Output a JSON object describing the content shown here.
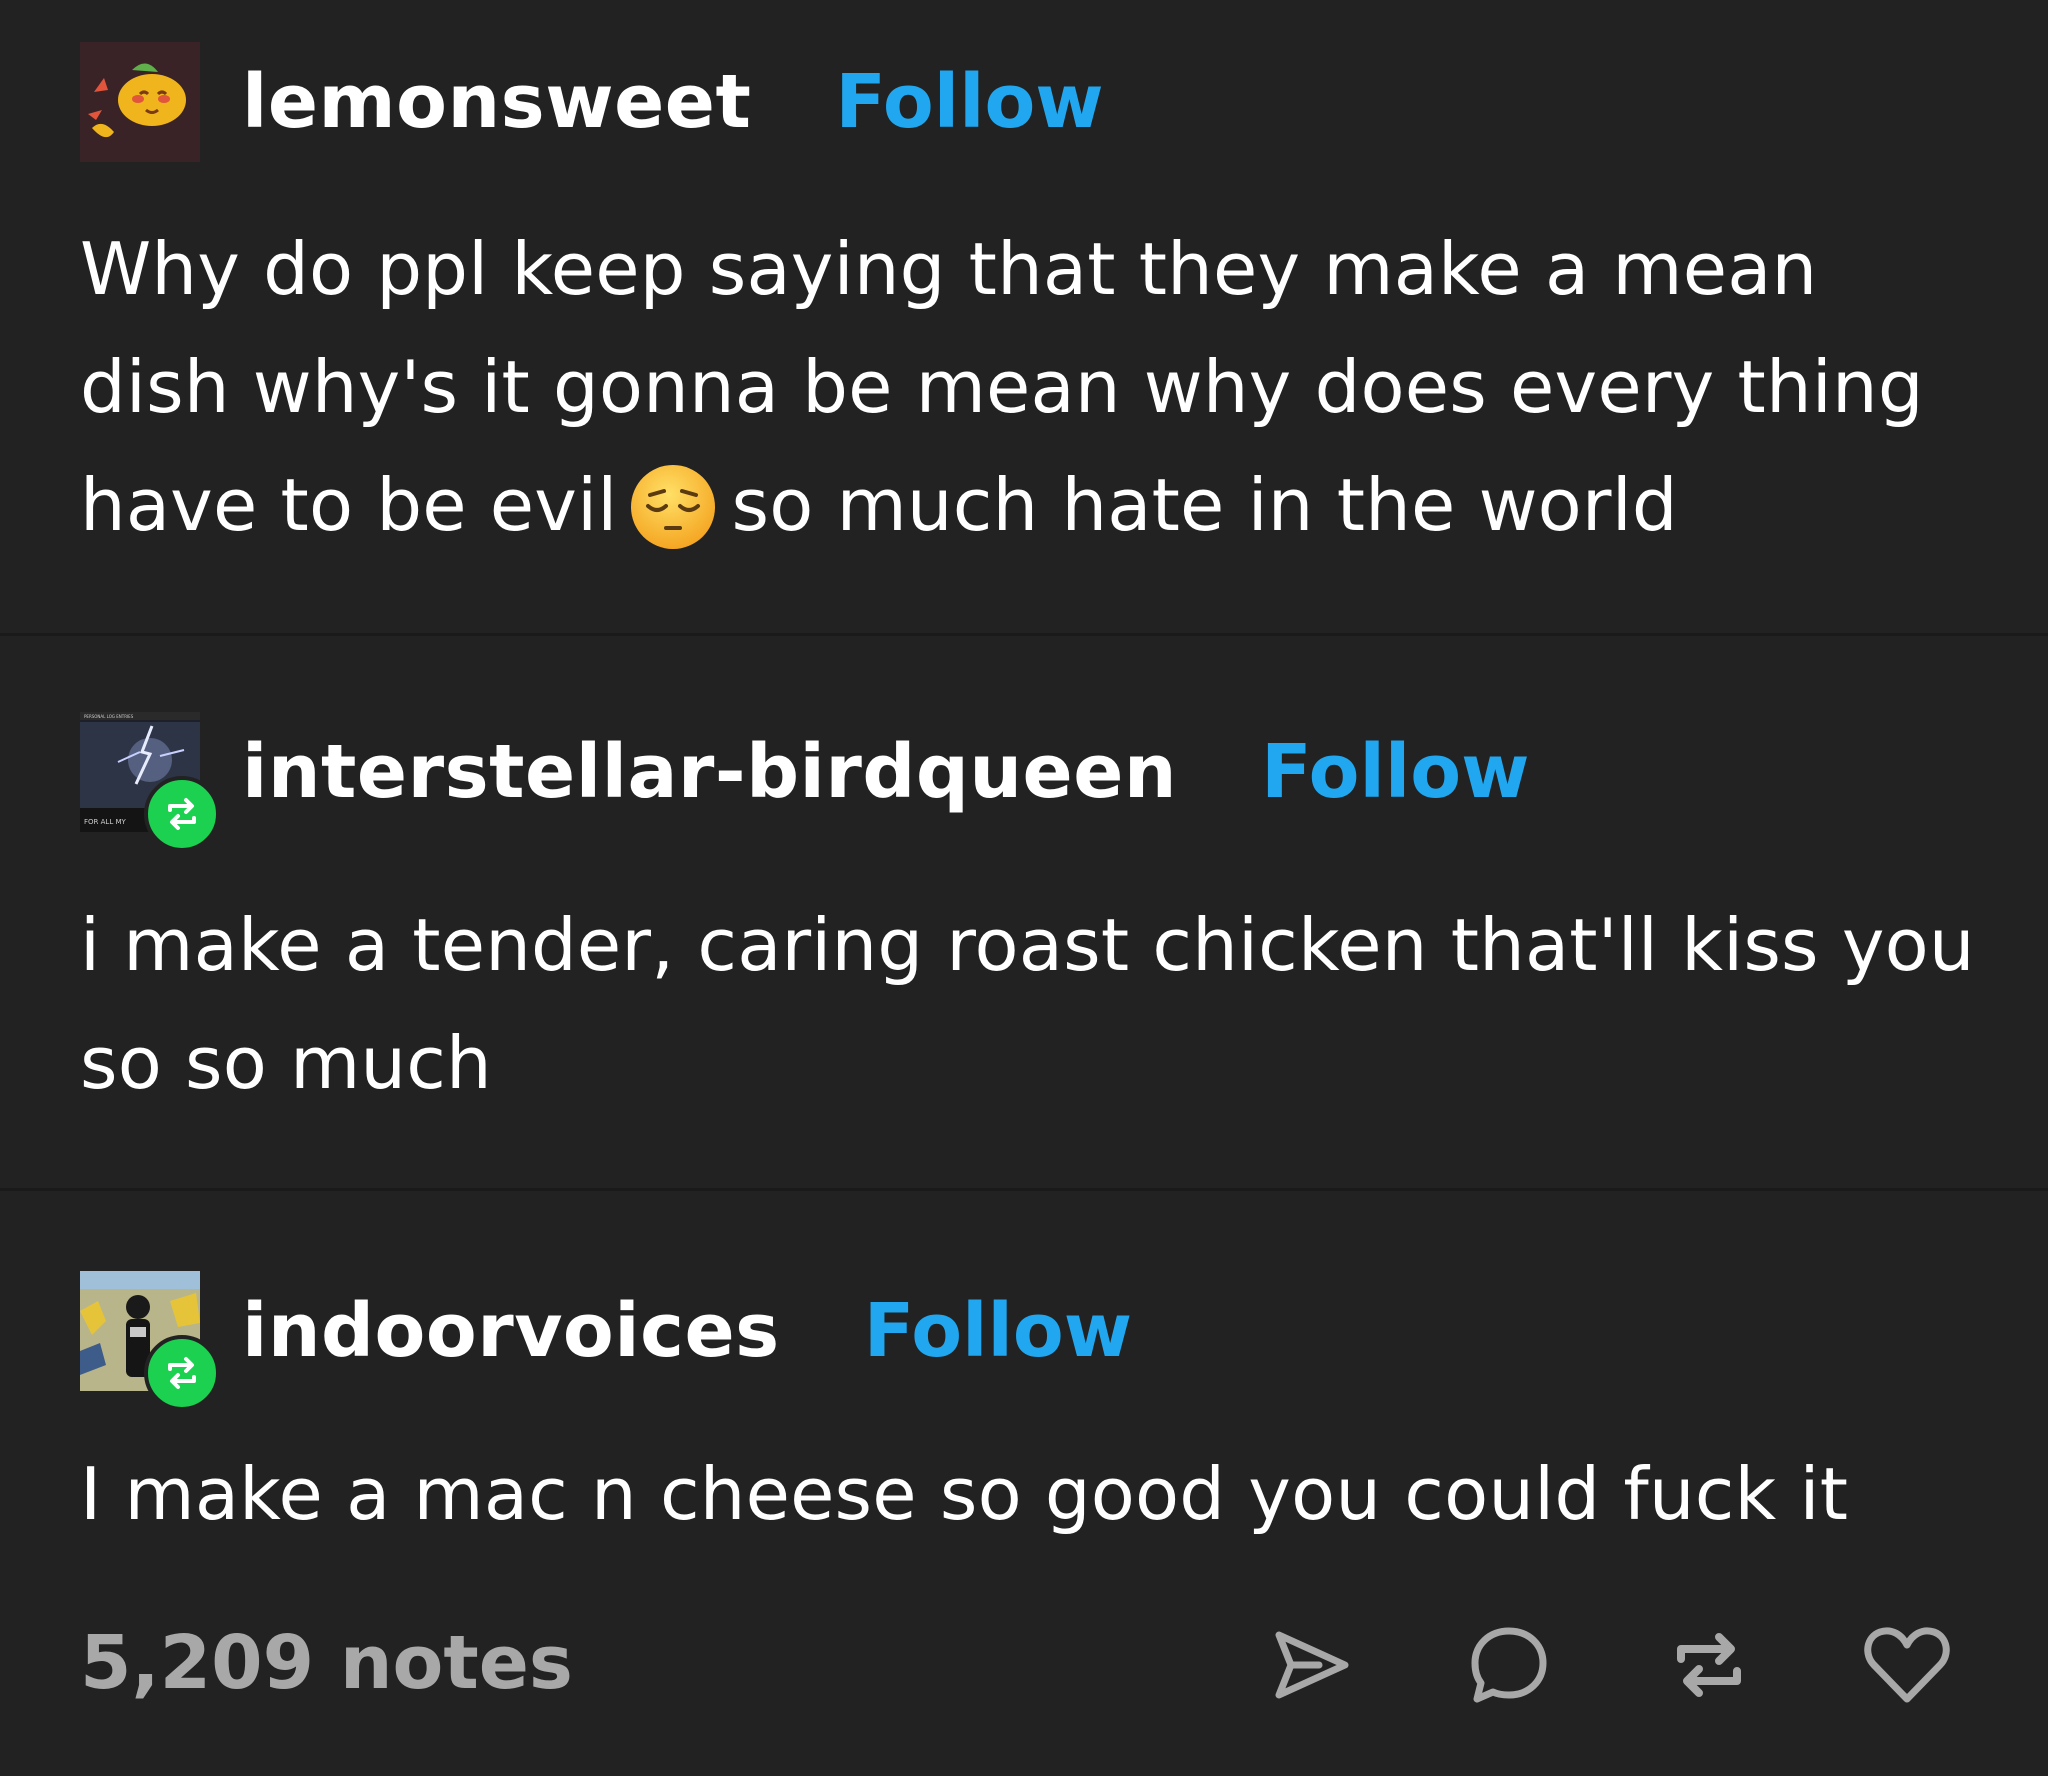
{
  "reblogs": [
    {
      "username": "lemonsweet",
      "follow_label": "Follow",
      "avatar_icon": "lemon-avatar",
      "is_reblog": false,
      "text_before_emoji": "Why do ppl keep saying that they make a mean dish why's it gonna be mean why does every thing have to be evil",
      "emoji": "pensive-face-emoji",
      "text_after_emoji": "so much hate in the world"
    },
    {
      "username": "interstellar-birdqueen",
      "follow_label": "Follow",
      "avatar_icon": "lightning-avatar",
      "avatar_caption_top": "PERSONAL LOG ENTRIES",
      "avatar_caption_bottom": "FOR ALL MY",
      "is_reblog": true,
      "text": "i make a tender, caring roast chicken that'll kiss you so so much"
    },
    {
      "username": "indoorvoices",
      "follow_label": "Follow",
      "avatar_icon": "person-avatar",
      "is_reblog": true,
      "text": "I make a mac n cheese so good you could fuck it"
    }
  ],
  "footer": {
    "notes": "5,209 notes",
    "actions": [
      "share-icon",
      "reply-icon",
      "reblog-icon",
      "like-icon"
    ]
  },
  "colors": {
    "background": "#222222",
    "follow_link": "#20a7f0",
    "reblog_badge": "#1bd14f",
    "notes_text": "#a8a8a8"
  }
}
